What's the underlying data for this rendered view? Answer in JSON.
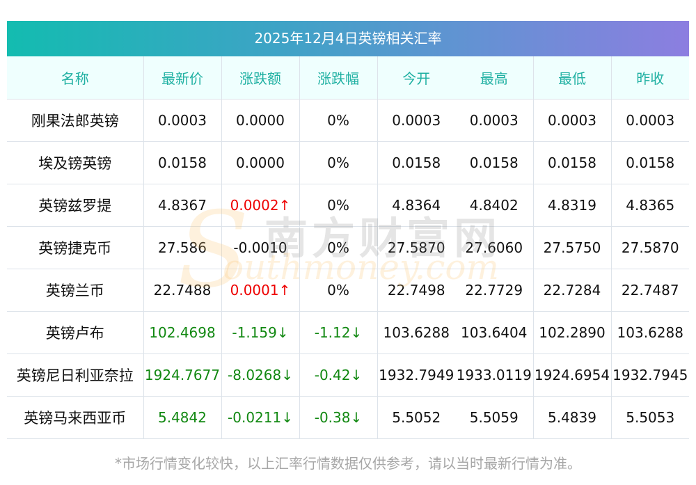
{
  "title": "2025年12月4日英镑相关汇率",
  "columns": [
    "名称",
    "最新价",
    "涨跌额",
    "涨跌幅",
    "今开",
    "最高",
    "最低",
    "昨收"
  ],
  "rows": [
    {
      "name": "刚果法郎英镑",
      "price": "0.0003",
      "change": "0.0000",
      "pct": "0%",
      "open": "0.0003",
      "high": "0.0003",
      "low": "0.0003",
      "prev": "0.0003",
      "trend": "flat"
    },
    {
      "name": "埃及镑英镑",
      "price": "0.0158",
      "change": "0.0000",
      "pct": "0%",
      "open": "0.0158",
      "high": "0.0158",
      "low": "0.0158",
      "prev": "0.0158",
      "trend": "flat"
    },
    {
      "name": "英镑兹罗提",
      "price": "4.8367",
      "change": "0.0002↑",
      "pct": "0%",
      "open": "4.8364",
      "high": "4.8402",
      "low": "4.8319",
      "prev": "4.8365",
      "trend": "up"
    },
    {
      "name": "英镑捷克币",
      "price": "27.586",
      "change": "-0.0010",
      "pct": "0%",
      "open": "27.5870",
      "high": "27.6060",
      "low": "27.5750",
      "prev": "27.5870",
      "trend": "flat"
    },
    {
      "name": "英镑兰币",
      "price": "22.7488",
      "change": "0.0001↑",
      "pct": "0%",
      "open": "22.7498",
      "high": "22.7729",
      "low": "22.7284",
      "prev": "22.7487",
      "trend": "up"
    },
    {
      "name": "英镑卢布",
      "price": "102.4698",
      "change": "-1.159↓",
      "pct": "-1.12↓",
      "open": "103.6288",
      "high": "103.6404",
      "low": "102.2890",
      "prev": "103.6288",
      "trend": "down"
    },
    {
      "name": "英镑尼日利亚奈拉",
      "price": "1924.7677",
      "change": "-8.0268↓",
      "pct": "-0.42↓",
      "open": "1932.7949",
      "high": "1933.0119",
      "low": "1924.6954",
      "prev": "1932.7945",
      "trend": "down"
    },
    {
      "name": "英镑马来西亚币",
      "price": "5.4842",
      "change": "-0.0211↓",
      "pct": "-0.38↓",
      "open": "5.5052",
      "high": "5.5059",
      "low": "5.4839",
      "prev": "5.5053",
      "trend": "down"
    }
  ],
  "watermark": {
    "cn": "南方财富网",
    "s": "S",
    "en": "outhmoney.com"
  },
  "footer": "*市场行情变化较快，以上汇率行情数据仅供参考，请以当时最新行情为准。",
  "colors": {
    "up": "#ee0000",
    "down": "#118811",
    "header_text": "#1fb0a2"
  }
}
